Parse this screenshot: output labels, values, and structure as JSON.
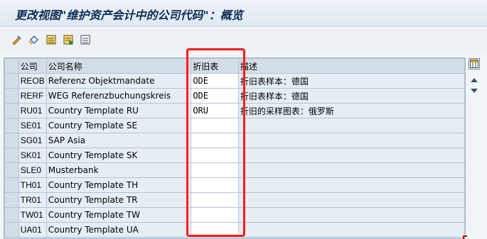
{
  "window": {
    "title": "更改视图\"维护资产会计中的公司代码\"：概览"
  },
  "toolbar": {
    "icons": [
      "edit-glasses-icon",
      "change-display-icon",
      "save-icon",
      "new-entries-icon",
      "copy-icon"
    ]
  },
  "table": {
    "headers": {
      "company": "公司",
      "company_name": "公司名称",
      "depreciation_chart": "折旧表",
      "description": "描述"
    },
    "rows": [
      {
        "company": "REOB",
        "name": "Referenz Objektmandate",
        "chart": "ODE",
        "description": "折旧表样本：德国"
      },
      {
        "company": "RERF",
        "name": "WEG Referenzbuchungskreis",
        "chart": "ODE",
        "description": "折旧表样本：德国"
      },
      {
        "company": "RU01",
        "name": "Country Template RU",
        "chart": "ORU",
        "description": "折旧的采样图表：俄罗斯"
      },
      {
        "company": "SE01",
        "name": "Country Template SE",
        "chart": "",
        "description": ""
      },
      {
        "company": "SG01",
        "name": "SAP Asia",
        "chart": "",
        "description": ""
      },
      {
        "company": "SK01",
        "name": "Country Template SK",
        "chart": "",
        "description": ""
      },
      {
        "company": "SLE0",
        "name": "Musterbank",
        "chart": "",
        "description": ""
      },
      {
        "company": "TH01",
        "name": "Country Template TH",
        "chart": "",
        "description": ""
      },
      {
        "company": "TR01",
        "name": "Country Template TR",
        "chart": "",
        "description": ""
      },
      {
        "company": "TW01",
        "name": "Country Template TW",
        "chart": "",
        "description": ""
      },
      {
        "company": "UA01",
        "name": "Country Template UA",
        "chart": "",
        "description": ""
      }
    ]
  },
  "colors": {
    "highlight": "#ff1a1a",
    "title_text": "#0d2c55"
  }
}
